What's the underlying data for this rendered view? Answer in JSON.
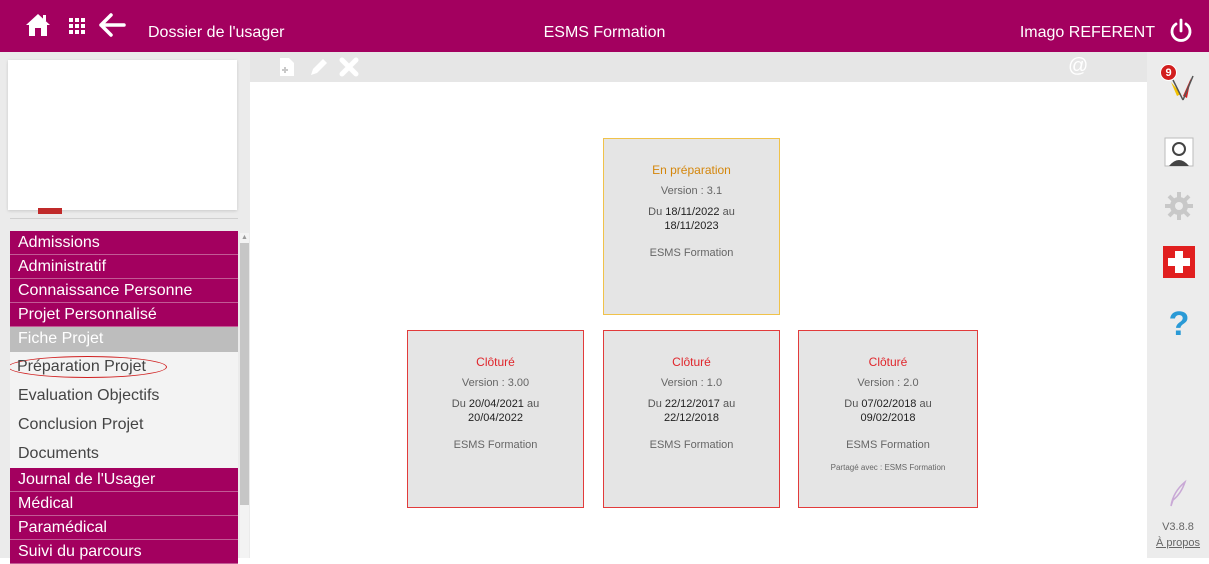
{
  "header": {
    "dossier_label": "Dossier de l'usager",
    "app_title": "ESMS Formation",
    "user": "Imago REFERENT"
  },
  "menu": [
    {
      "label": "Admissions",
      "kind": "cat"
    },
    {
      "label": "Administratif",
      "kind": "cat"
    },
    {
      "label": "Connaissance Personne",
      "kind": "cat"
    },
    {
      "label": "Projet Personnalisé",
      "kind": "cat"
    },
    {
      "label": "Fiche Projet",
      "kind": "sel"
    },
    {
      "label": "Préparation Projet",
      "kind": "sub"
    },
    {
      "label": "Evaluation Objectifs",
      "kind": "sub"
    },
    {
      "label": "Conclusion Projet",
      "kind": "sub"
    },
    {
      "label": "Documents",
      "kind": "sub"
    },
    {
      "label": "Journal de l'Usager",
      "kind": "cat"
    },
    {
      "label": "Médical",
      "kind": "cat"
    },
    {
      "label": "Paramédical",
      "kind": "cat"
    },
    {
      "label": "Suivi du parcours",
      "kind": "cat"
    }
  ],
  "toolbar": {
    "at_symbol": "@"
  },
  "cards": [
    {
      "status": "En préparation",
      "version": "Version : 3.1",
      "from_prefix": "Du",
      "from": "18/11/2022",
      "to_prefix": "au",
      "to": "18/11/2023",
      "org": "ESMS Formation",
      "share": ""
    },
    {
      "status": "Clôturé",
      "version": "Version : 3.00",
      "from_prefix": "Du",
      "from": "20/04/2021",
      "to_prefix": "au",
      "to": "20/04/2022",
      "org": "ESMS Formation",
      "share": ""
    },
    {
      "status": "Clôturé",
      "version": "Version : 1.0",
      "from_prefix": "Du",
      "from": "22/12/2017",
      "to_prefix": "au",
      "to": "22/12/2018",
      "org": "ESMS Formation",
      "share": ""
    },
    {
      "status": "Clôturé",
      "version": "Version : 2.0",
      "from_prefix": "Du",
      "from": "07/02/2018",
      "to_prefix": "au",
      "to": "09/02/2018",
      "org": "ESMS Formation",
      "share": "Partagé avec : ESMS Formation"
    }
  ],
  "right_panel": {
    "notification_count": "9",
    "version": "V3.8.8",
    "about": "À propos"
  },
  "colors": {
    "brand": "#a3005f",
    "active_border": "#f0c24a",
    "closed_border": "#e23b3b"
  }
}
